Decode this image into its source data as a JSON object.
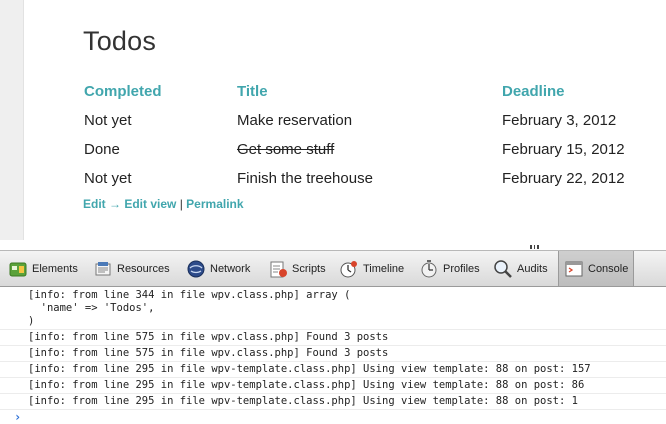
{
  "page": {
    "title": "Todos",
    "table": {
      "headers": [
        "Completed",
        "Title",
        "Deadline"
      ],
      "rows": [
        {
          "completed": "Not yet",
          "title": "Make reservation",
          "deadline": "February 3, 2012"
        },
        {
          "completed": "Done",
          "title": "Get some stuff",
          "deadline": "February 15, 2012"
        },
        {
          "completed": "Not yet",
          "title": "Finish the treehouse",
          "deadline": "February 22, 2012"
        }
      ]
    },
    "links": {
      "edit": "Edit → Edit view",
      "separator": "|",
      "permalink": "Permalink"
    }
  },
  "devtools": {
    "tabs": [
      {
        "label": "Elements",
        "icon": "elements-icon"
      },
      {
        "label": "Resources",
        "icon": "resources-icon"
      },
      {
        "label": "Network",
        "icon": "network-icon"
      },
      {
        "label": "Scripts",
        "icon": "scripts-icon"
      },
      {
        "label": "Timeline",
        "icon": "timeline-icon"
      },
      {
        "label": "Profiles",
        "icon": "profiles-icon"
      },
      {
        "label": "Audits",
        "icon": "audits-icon"
      },
      {
        "label": "Console",
        "icon": "console-icon"
      }
    ],
    "active_tab": "Console",
    "console": {
      "lines": [
        "[info: from line 344 in file wpv.class.php] array (",
        "  'name' => 'Todos',",
        ")",
        "[info: from line 575 in file wpv.class.php] Found 3 posts",
        "[info: from line 575 in file wpv.class.php] Found 3 posts",
        "[info: from line 295 in file wpv-template.class.php] Using view template: 88 on post: 157",
        "[info: from line 295 in file wpv-template.class.php] Using view template: 88 on post: 86",
        "[info: from line 295 in file wpv-template.class.php] Using view template: 88 on post: 1"
      ],
      "prompt": "›"
    }
  },
  "colors": {
    "accent": "#41a6ad",
    "prompt": "#2a6fd6"
  }
}
